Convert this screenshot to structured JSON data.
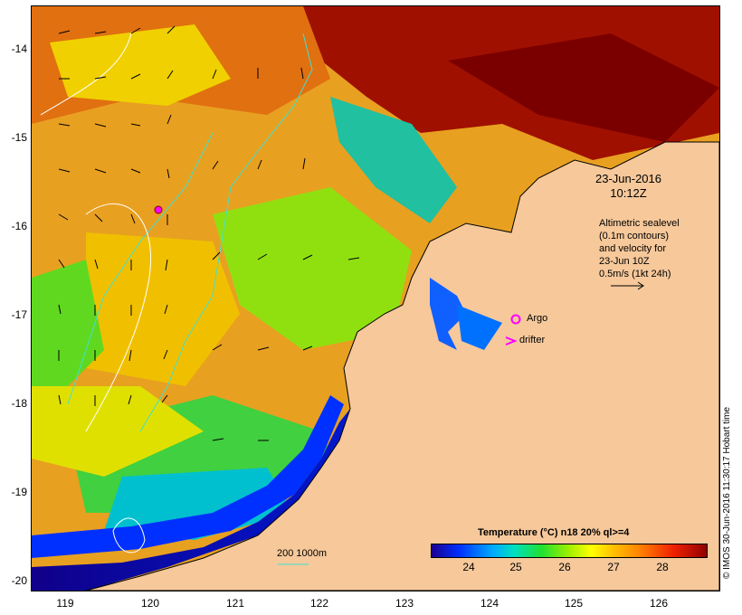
{
  "axes": {
    "y_ticks": [
      "-14",
      "-15",
      "-16",
      "-17",
      "-18",
      "-19",
      "-20"
    ],
    "x_ticks": [
      "119",
      "120",
      "121",
      "122",
      "123",
      "124",
      "125",
      "126"
    ]
  },
  "annotation": {
    "datetime_line1": "23-Jun-2016",
    "datetime_line2": "10:12Z",
    "sealevel_note": "Altimetric sealevel\n(0.1m contours)\nand velocity for\n23-Jun 10Z\n0.5m/s (1kt 24h)"
  },
  "legend": {
    "argo_label": "Argo",
    "drifter_label": "drifter",
    "depth_label": "200  1000m",
    "argo_color": "#ff00ff",
    "depth_color": "#40e0d0"
  },
  "colorbar": {
    "title": "Temperature (°C) n18 20% ql>=4",
    "ticks": [
      "24",
      "25",
      "26",
      "27",
      "28"
    ]
  },
  "credit": "© IMOS 30-Jun-2016 11:30:17 Hobart time",
  "colors": {
    "land": "#f6c89a",
    "sst_cold": "#1a0090",
    "sst_warm": "#900000"
  }
}
